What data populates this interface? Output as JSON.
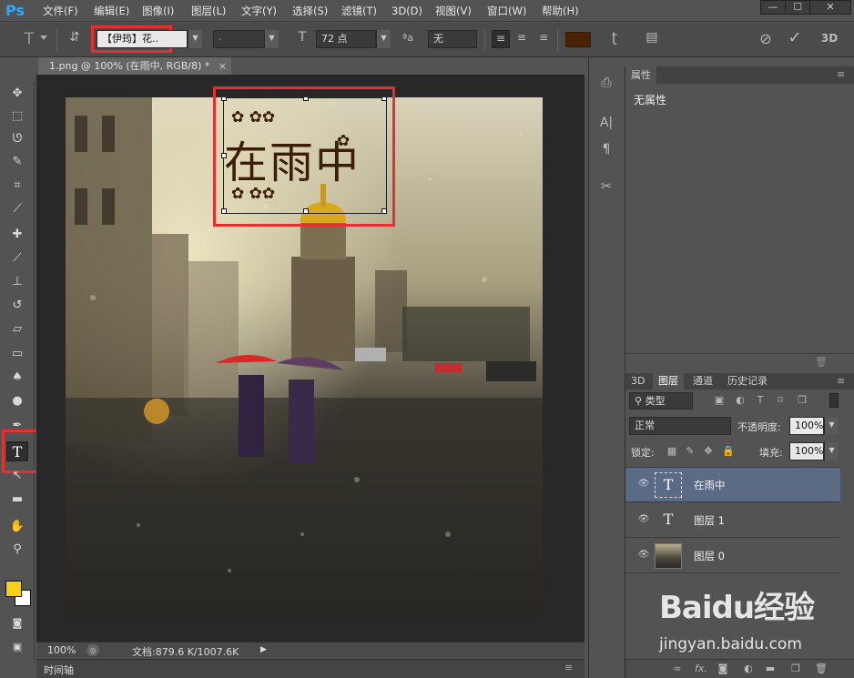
{
  "app": {
    "logo": "Ps"
  },
  "menu": [
    "文件(F)",
    "编辑(E)",
    "图像(I)",
    "图层(L)",
    "文字(Y)",
    "选择(S)",
    "滤镜(T)",
    "3D(D)",
    "视图(V)",
    "窗口(W)",
    "帮助(H)"
  ],
  "window_controls": {
    "minimize": "—",
    "maximize": "☐",
    "close": "✕"
  },
  "options": {
    "font_family": "【伊筠】花..",
    "font_style": "-",
    "font_size": "72 点",
    "aa_label": "ªa",
    "antialias": "无",
    "three_d": "3D",
    "color_hex": "#4a2200"
  },
  "document": {
    "tab_label": "1.png @ 100% (在雨中, RGB/8) *",
    "tab_close": "×",
    "text_layer_content": "在雨中",
    "text_color": "#3b1d08"
  },
  "status": {
    "zoom": "100%",
    "doc_info": "文档:879.6 K/1007.6K"
  },
  "timeline": {
    "label": "时间轴"
  },
  "properties": {
    "tab": "属性",
    "content": "无属性"
  },
  "layers_panel": {
    "tabs": [
      "3D",
      "图层",
      "通道",
      "历史记录"
    ],
    "filter_kind": "类型",
    "blend_mode": "正常",
    "opacity_label": "不透明度:",
    "opacity_value": "100%",
    "lock_label": "锁定:",
    "fill_label": "填充:",
    "fill_value": "100%",
    "rows": [
      {
        "name": "在雨中",
        "type": "text",
        "selected": true
      },
      {
        "name": "图层 1",
        "type": "text",
        "selected": false
      },
      {
        "name": "图层 0",
        "type": "image",
        "selected": false
      }
    ],
    "fx": "fx."
  },
  "colors": {
    "foreground": "#f5d218",
    "background": "#ffffff",
    "accent_red": "#e43030"
  },
  "watermark": {
    "brand": "Baidu经验",
    "url": "jingyan.baidu.com"
  }
}
